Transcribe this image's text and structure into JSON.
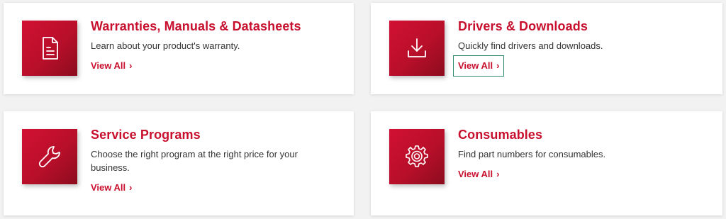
{
  "cards": [
    {
      "icon": "document-icon",
      "title": "Warranties, Manuals & Datasheets",
      "description": "Learn about your product's warranty.",
      "link_label": "View All",
      "link_chevron": "›"
    },
    {
      "icon": "download-icon",
      "title": "Drivers & Downloads",
      "description": "Quickly find drivers and downloads.",
      "link_label": "View All",
      "link_chevron": "›"
    },
    {
      "icon": "wrench-icon",
      "title": "Service Programs",
      "description": "Choose the right program at the right price for your business.",
      "link_label": "View All",
      "link_chevron": "›"
    },
    {
      "icon": "gear-icon",
      "title": "Consumables",
      "description": "Find part numbers for consumables.",
      "link_label": "View All",
      "link_chevron": "›"
    }
  ],
  "colors": {
    "accent": "#c8102e",
    "page_background": "#f2f2f2",
    "focus_outline": "#2e8b6e"
  }
}
